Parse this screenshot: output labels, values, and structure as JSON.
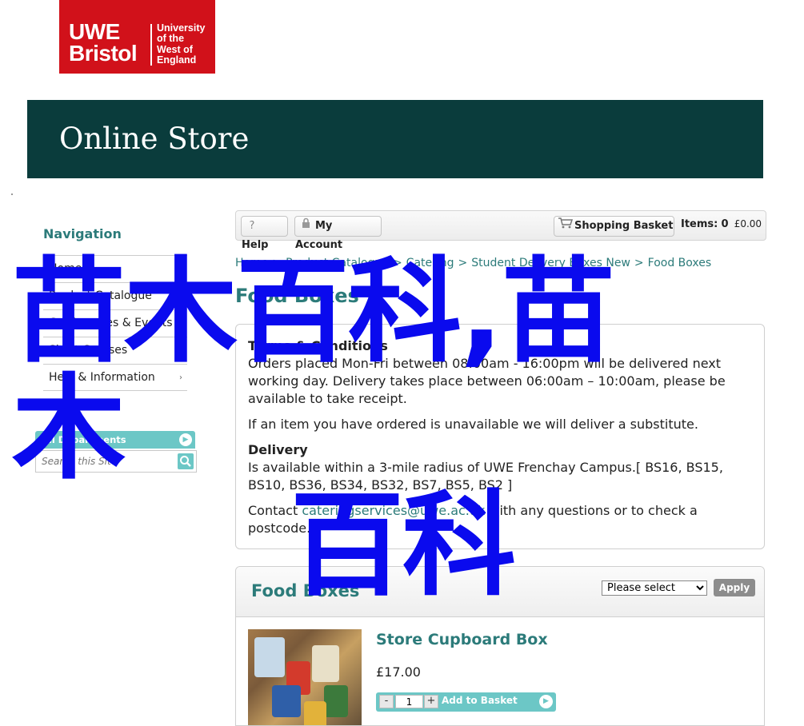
{
  "logo": {
    "line1": "UWE",
    "line2": "Bristol",
    "university": "University\nof the\nWest of\nEngland"
  },
  "banner": {
    "title": "Online Store"
  },
  "sidebar": {
    "title": "Navigation",
    "items": [
      {
        "label": "Home"
      },
      {
        "label": "Product Catalogue"
      },
      {
        "label": "Conferences & Events"
      },
      {
        "label": "Short Courses"
      },
      {
        "label": "Help & Information",
        "has_arrow": true
      }
    ],
    "departments_label": "All Departments",
    "search_placeholder": "Search this Site"
  },
  "toolbar": {
    "help_label": "Help",
    "account_label": "My Account",
    "basket_label": "Shopping Basket",
    "items_label": "Items:",
    "items_count": "0",
    "items_total": "£0.00"
  },
  "breadcrumb": [
    "Home",
    "Product Catalogue",
    "Catering",
    "Student Delivery Boxes New",
    "Food Boxes"
  ],
  "page_title": "Food Boxes",
  "terms": {
    "heading": "Terms & Conditions",
    "text1": "Orders placed Mon-Fri between 08:00am - 16:00pm will be delivered next working day. Delivery takes place between 06:00am – 10:00am, please be available to take receipt.",
    "text2": "If an item you have ordered is unavailable we will deliver a substitute.",
    "delivery_heading": "Delivery",
    "delivery_text": "Is available within a 3-mile radius of UWE Frenchay Campus.[ BS16, BS15, BS10, BS36, BS34, BS32, BS7, BS5, BS2 ]",
    "contact_prefix": "Contact",
    "contact_email": "cateringservices@uwe.ac.uk",
    "contact_suffix": "with any questions or to check a postcode."
  },
  "food_boxes": {
    "title": "Food Boxes",
    "sort_selected": "Please select",
    "apply_label": "Apply",
    "products": [
      {
        "name": "Store Cupboard Box",
        "price": "£17.00",
        "qty": "1",
        "add_label": "Add to Basket"
      }
    ]
  },
  "watermark": {
    "line1": "苗木百科,苗木",
    "line2": "百科"
  },
  "colors": {
    "brand_red": "#d1111a",
    "banner": "#0a3c3c",
    "accent_teal": "#2c7b7a",
    "button_teal": "#6cc7c6",
    "watermark": "#0a0aee"
  }
}
